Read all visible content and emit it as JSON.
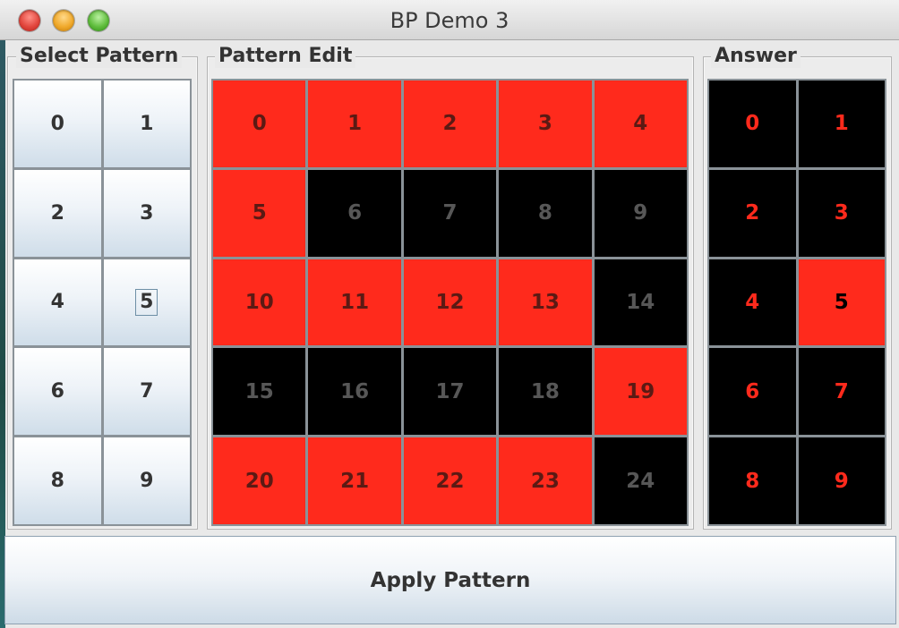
{
  "window": {
    "title": "BP Demo 3"
  },
  "select_pattern": {
    "title": "Select Pattern",
    "buttons": [
      "0",
      "1",
      "2",
      "3",
      "4",
      "5",
      "6",
      "7",
      "8",
      "9"
    ],
    "focused_index": 5
  },
  "pattern_edit": {
    "title": "Pattern Edit",
    "cells": [
      {
        "label": "0",
        "on": true
      },
      {
        "label": "1",
        "on": true
      },
      {
        "label": "2",
        "on": true
      },
      {
        "label": "3",
        "on": true
      },
      {
        "label": "4",
        "on": true
      },
      {
        "label": "5",
        "on": true
      },
      {
        "label": "6",
        "on": false
      },
      {
        "label": "7",
        "on": false
      },
      {
        "label": "8",
        "on": false
      },
      {
        "label": "9",
        "on": false
      },
      {
        "label": "10",
        "on": true
      },
      {
        "label": "11",
        "on": true
      },
      {
        "label": "12",
        "on": true
      },
      {
        "label": "13",
        "on": true
      },
      {
        "label": "14",
        "on": false
      },
      {
        "label": "15",
        "on": false
      },
      {
        "label": "16",
        "on": false
      },
      {
        "label": "17",
        "on": false
      },
      {
        "label": "18",
        "on": false
      },
      {
        "label": "19",
        "on": true
      },
      {
        "label": "20",
        "on": true
      },
      {
        "label": "21",
        "on": true
      },
      {
        "label": "22",
        "on": true
      },
      {
        "label": "23",
        "on": true
      },
      {
        "label": "24",
        "on": false
      }
    ]
  },
  "answer": {
    "title": "Answer",
    "cells": [
      {
        "label": "0",
        "on": false
      },
      {
        "label": "1",
        "on": false
      },
      {
        "label": "2",
        "on": false
      },
      {
        "label": "3",
        "on": false
      },
      {
        "label": "4",
        "on": false
      },
      {
        "label": "5",
        "on": true
      },
      {
        "label": "6",
        "on": false
      },
      {
        "label": "7",
        "on": false
      },
      {
        "label": "8",
        "on": false
      },
      {
        "label": "9",
        "on": false
      }
    ]
  },
  "apply_button": {
    "label": "Apply Pattern"
  },
  "colors": {
    "on": "#ff2a1c",
    "off": "#000000"
  }
}
